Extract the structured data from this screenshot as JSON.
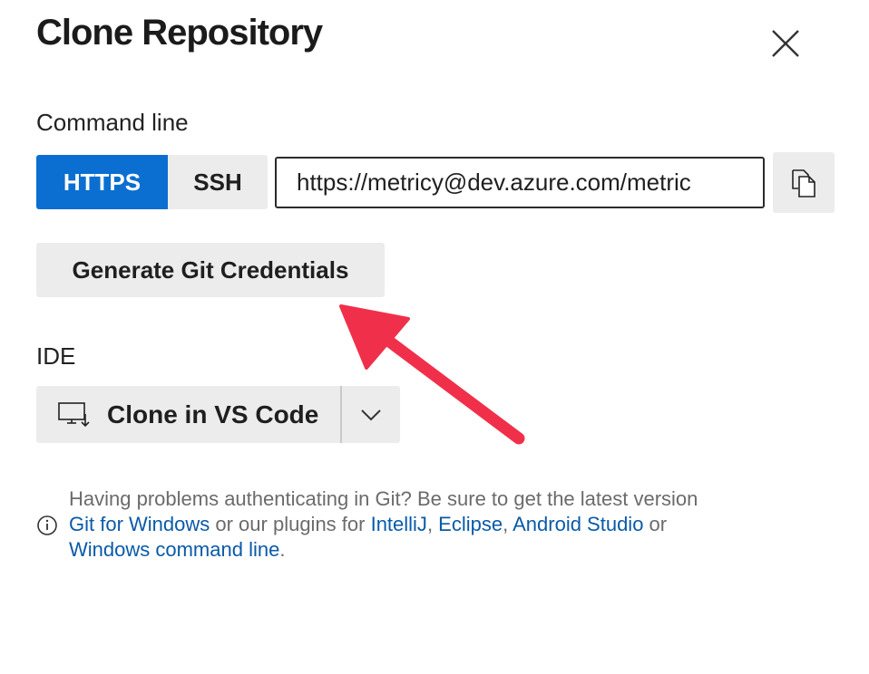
{
  "dialog": {
    "title": "Clone Repository",
    "close_icon": "close-icon"
  },
  "command_line": {
    "label": "Command line",
    "protocols": [
      {
        "label": "HTTPS",
        "selected": true
      },
      {
        "label": "SSH",
        "selected": false
      }
    ],
    "url_value": "https://metricy@dev.azure.com/metric",
    "copy_icon": "copy-icon"
  },
  "credentials": {
    "button_label": "Generate Git Credentials"
  },
  "ide": {
    "label": "IDE",
    "clone_label": "Clone in VS Code",
    "clone_icon": "monitor-download-icon",
    "dropdown_icon": "chevron-down-icon"
  },
  "help": {
    "text_1": "Having problems authenticating in Git? Be sure to get the latest version",
    "link_git_windows": "Git for Windows",
    "text_2": " or our plugins for ",
    "link_intellij": "IntelliJ",
    "sep_1": ", ",
    "link_eclipse": "Eclipse",
    "sep_2": ", ",
    "link_android": "Android Studio",
    "text_3": " or",
    "link_cmdline": "Windows command line",
    "text_end": "."
  },
  "annotation": {
    "arrow_color": "#f0304a"
  },
  "colors": {
    "primary": "#0a6fd1",
    "link": "#0a5aa8",
    "button_bg": "#ececec"
  }
}
